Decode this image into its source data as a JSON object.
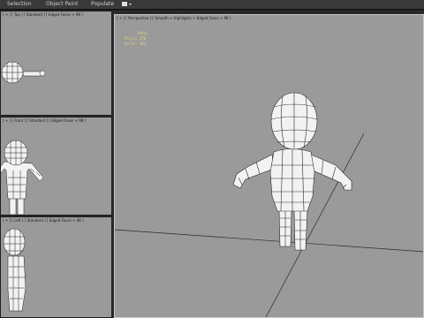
{
  "menubar": {
    "items": [
      "Selection",
      "Object Paint",
      "Populate"
    ],
    "dropdown_icon": "layout-dropdown-icon"
  },
  "viewports": {
    "top_left_label": "[ + ] [ Top ] [ Standard ] [ Edged Faces + 98 ]",
    "mid_left_label": "[ + ] [ Front ] [ Standard ] [ Edged Faces + 98 ]",
    "bottom_left_label": "[ + ] [ Left ] [ Standard ] [ Edged Faces + 98 ]",
    "perspective_label": "[ + ] [ Perspective ] [ Smooth + Highlights + Edged Faces + 98 ]"
  },
  "stats": {
    "header": "Total",
    "polys_label": "Polys: 370",
    "verts_label": "Verts: 383"
  },
  "colors": {
    "viewport_bg": "#9a9a9a",
    "viewport_border": "#1e1e1e",
    "stats_text": "#e8d47a",
    "mesh_fill": "#f2f2f2",
    "mesh_wire": "#222222",
    "active_border": "#c8c8c8"
  }
}
